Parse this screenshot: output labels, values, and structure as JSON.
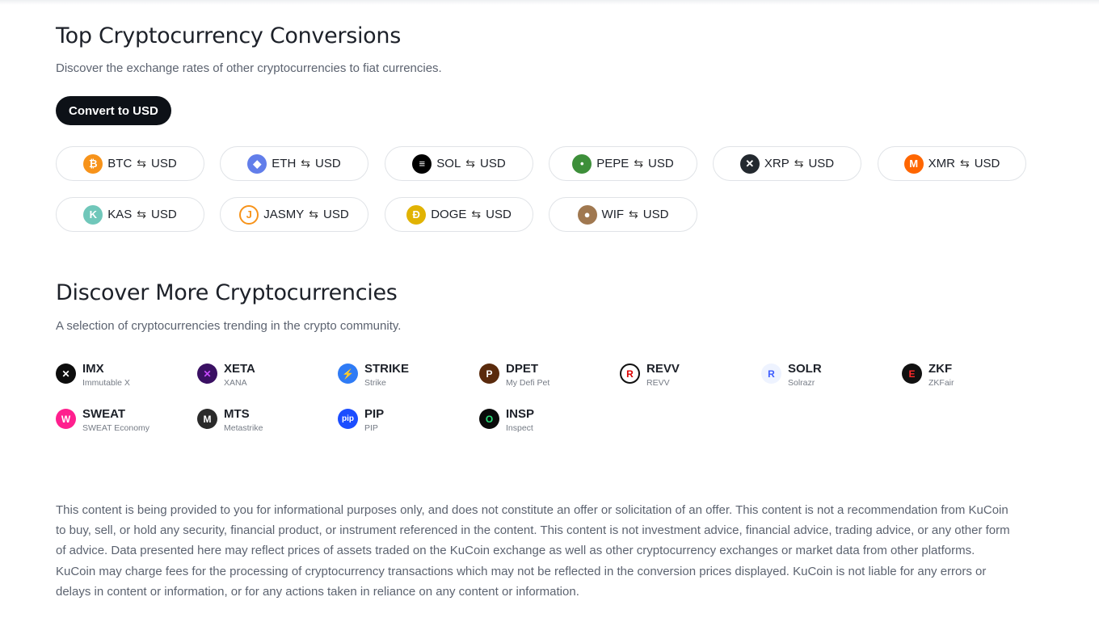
{
  "conversions": {
    "title": "Top Cryptocurrency Conversions",
    "subtitle": "Discover the exchange rates of other cryptocurrencies to fiat currencies.",
    "tab_label": "Convert to USD",
    "swap_symbol": "⇆",
    "pairs": [
      {
        "base": "BTC",
        "quote": "USD",
        "icon": "bitcoin-icon",
        "color": "#f7931a"
      },
      {
        "base": "ETH",
        "quote": "USD",
        "icon": "ethereum-icon",
        "color": "#627eea"
      },
      {
        "base": "SOL",
        "quote": "USD",
        "icon": "solana-icon",
        "color": "#000000"
      },
      {
        "base": "PEPE",
        "quote": "USD",
        "icon": "pepe-icon",
        "color": "#3d8f3a"
      },
      {
        "base": "XRP",
        "quote": "USD",
        "icon": "xrp-icon",
        "color": "#23292f"
      },
      {
        "base": "XMR",
        "quote": "USD",
        "icon": "monero-icon",
        "color": "#ff6600"
      },
      {
        "base": "KAS",
        "quote": "USD",
        "icon": "kaspa-icon",
        "color": "#70c7ba"
      },
      {
        "base": "JASMY",
        "quote": "USD",
        "icon": "jasmy-icon",
        "color": "#f7931a"
      },
      {
        "base": "DOGE",
        "quote": "USD",
        "icon": "dogecoin-icon",
        "color": "#e1b303"
      },
      {
        "base": "WIF",
        "quote": "USD",
        "icon": "dogwifhat-icon",
        "color": "#a07850"
      }
    ]
  },
  "discover": {
    "title": "Discover More Cryptocurrencies",
    "subtitle": "A selection of cryptocurrencies trending in the crypto community.",
    "coins": [
      {
        "symbol": "IMX",
        "name": "Immutable X",
        "icon": "immutable-x-icon",
        "color": "#0d0d0d"
      },
      {
        "symbol": "XETA",
        "name": "XANA",
        "icon": "xana-icon",
        "color": "#3a1063"
      },
      {
        "symbol": "STRIKE",
        "name": "Strike",
        "icon": "strike-icon",
        "color": "#2f7bf5"
      },
      {
        "symbol": "DPET",
        "name": "My Defi Pet",
        "icon": "my-defi-pet-icon",
        "color": "#5a2a0c"
      },
      {
        "symbol": "REVV",
        "name": "REVV",
        "icon": "revv-icon",
        "color": "#ffffff"
      },
      {
        "symbol": "SOLR",
        "name": "Solrazr",
        "icon": "solrazr-icon",
        "color": "#eef3ff"
      },
      {
        "symbol": "ZKF",
        "name": "ZKFair",
        "icon": "zkfair-icon",
        "color": "#111111"
      },
      {
        "symbol": "SWEAT",
        "name": "SWEAT Economy",
        "icon": "sweat-icon",
        "color": "#ff1f8e"
      },
      {
        "symbol": "MTS",
        "name": "Metastrike",
        "icon": "metastrike-icon",
        "color": "#2a2a2a"
      },
      {
        "symbol": "PIP",
        "name": "PIP",
        "icon": "pip-icon",
        "color": "#1b4dff"
      },
      {
        "symbol": "INSP",
        "name": "Inspect",
        "icon": "inspect-icon",
        "color": "#0a0a0a"
      }
    ]
  },
  "disclaimer": "This content is being provided to you for informational purposes only, and does not constitute an offer or solicitation of an offer. This content is not a recommendation from KuCoin to buy, sell, or hold any security, financial product, or instrument referenced in the content. This content is not investment advice, financial advice, trading advice, or any other form of advice. Data presented here may reflect prices of assets traded on the KuCoin exchange as well as other cryptocurrency exchanges or market data from other platforms. KuCoin may charge fees for the processing of cryptocurrency transactions which may not be reflected in the conversion prices displayed. KuCoin is not liable for any errors or delays in content or information, or for any actions taken in reliance on any content or information."
}
